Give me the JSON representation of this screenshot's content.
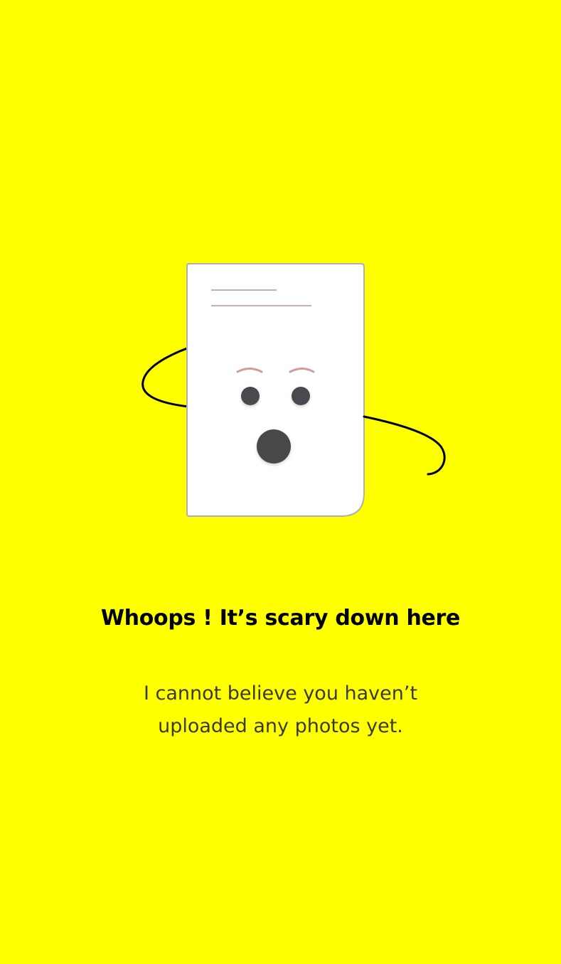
{
  "theme": {
    "background": "#FFFF00",
    "title_color": "#000000",
    "message_color": "#3A3A2A",
    "paper_color": "#FFFFFF",
    "paper_border": "#B0B0B0",
    "brow_color": "#D49A9A",
    "eye_color": "#4B4950",
    "mouth_color": "#4A4646",
    "line_color": "#C8AEB4",
    "swirl_color": "#000000"
  },
  "illustration": {
    "icon": "scared-document-icon"
  },
  "empty_state": {
    "title": "Whoops ! It’s scary down here",
    "message": "I cannot believe you haven’t uploaded any photos yet."
  }
}
